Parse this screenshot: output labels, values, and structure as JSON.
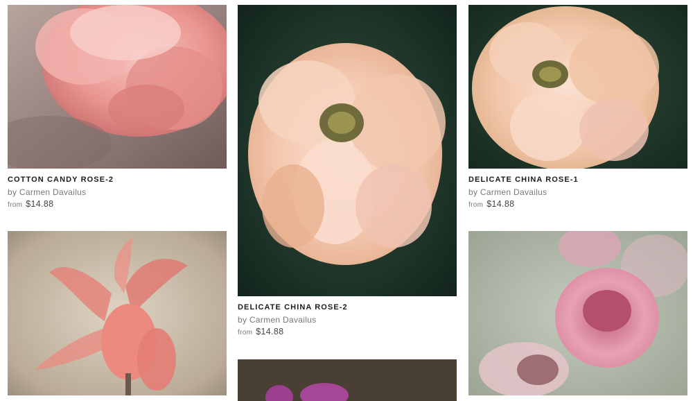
{
  "gallery": {
    "by_prefix": "by",
    "from_prefix": "from",
    "items": [
      {
        "title": "COTTON CANDY ROSE-2",
        "artist": "Carmen Davailus",
        "price": "$14.88"
      },
      {
        "title": "DELICATE CHINA ROSE-2",
        "artist": "Carmen Davailus",
        "price": "$14.88"
      },
      {
        "title": "DELICATE CHINA ROSE-1",
        "artist": "Carmen Davailus",
        "price": "$14.88"
      },
      {
        "title": "",
        "artist": "",
        "price": ""
      },
      {
        "title": "",
        "artist": "",
        "price": ""
      },
      {
        "title": "",
        "artist": "",
        "price": ""
      }
    ]
  }
}
